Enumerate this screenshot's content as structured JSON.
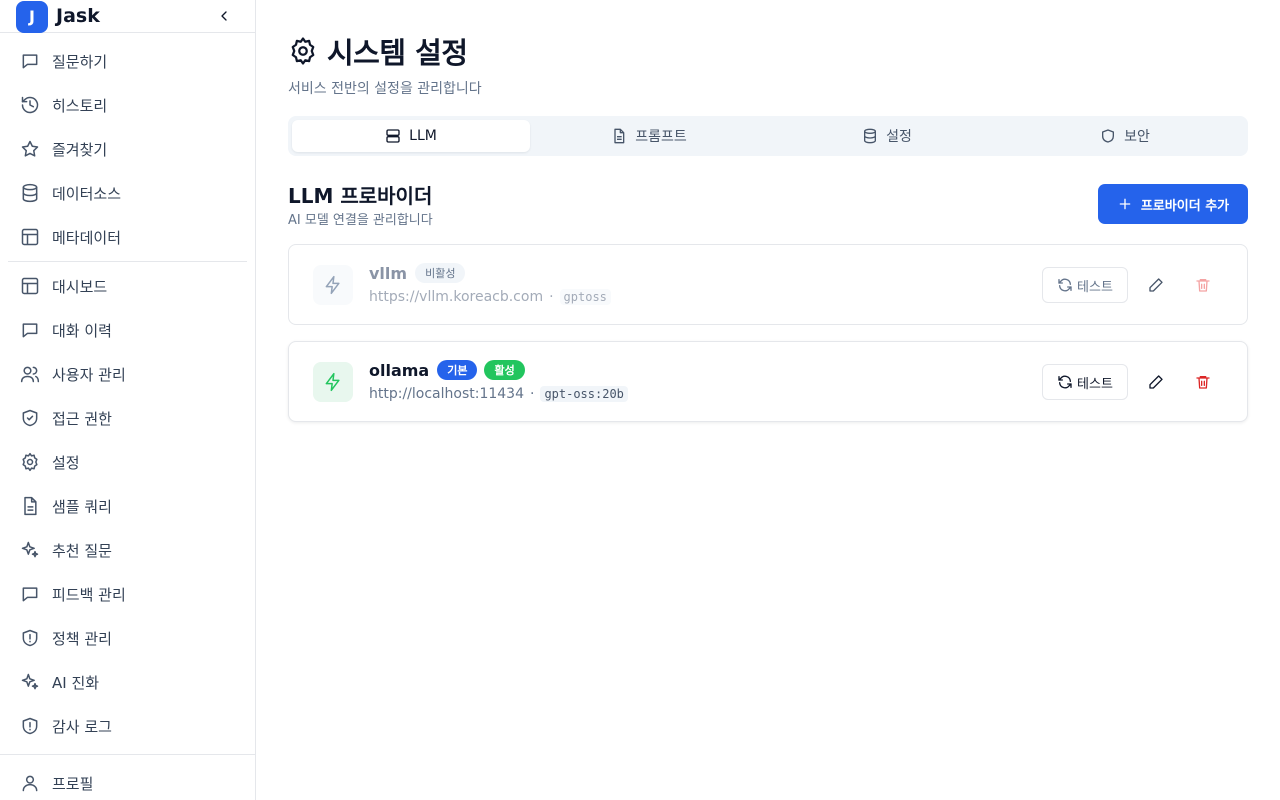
{
  "brand": {
    "logo_letter": "J",
    "name": "Jask"
  },
  "sidebar": {
    "group1": [
      {
        "label": "질문하기",
        "icon": "message-icon"
      },
      {
        "label": "히스토리",
        "icon": "history-icon"
      },
      {
        "label": "즐겨찾기",
        "icon": "star-icon"
      },
      {
        "label": "데이터소스",
        "icon": "database-icon"
      },
      {
        "label": "메타데이터",
        "icon": "layout-icon"
      }
    ],
    "group2": [
      {
        "label": "대시보드",
        "icon": "layout-icon"
      },
      {
        "label": "대화 이력",
        "icon": "message-icon"
      },
      {
        "label": "사용자 관리",
        "icon": "users-icon"
      },
      {
        "label": "접근 권한",
        "icon": "shield-check-icon"
      },
      {
        "label": "설정",
        "icon": "gear-icon"
      },
      {
        "label": "샘플 쿼리",
        "icon": "file-icon"
      },
      {
        "label": "추천 질문",
        "icon": "sparkles-icon"
      },
      {
        "label": "피드백 관리",
        "icon": "message-icon"
      },
      {
        "label": "정책 관리",
        "icon": "shield-alert-icon"
      },
      {
        "label": "AI 진화",
        "icon": "sparkles-icon"
      },
      {
        "label": "감사 로그",
        "icon": "shield-alert-icon"
      }
    ],
    "group3": [
      {
        "label": "프로필",
        "icon": "user-icon"
      }
    ]
  },
  "header": {
    "title": "시스템 설정",
    "subtitle": "서비스 전반의 설정을 관리합니다"
  },
  "tabs": [
    {
      "label": "LLM",
      "icon": "server-icon",
      "active": true
    },
    {
      "label": "프롬프트",
      "icon": "file-icon",
      "active": false
    },
    {
      "label": "설정",
      "icon": "database-icon",
      "active": false
    },
    {
      "label": "보안",
      "icon": "shield-icon",
      "active": false
    }
  ],
  "section": {
    "title": "LLM 프로바이더",
    "subtitle": "AI 모델 연결을 관리합니다",
    "add_label": "프로바이더 추가"
  },
  "providers": [
    {
      "name": "vllm",
      "badges": [
        "비활성"
      ],
      "url": "https://vllm.koreacb.com",
      "separator": "·",
      "model": "gptoss",
      "test_label": "테스트"
    },
    {
      "name": "ollama",
      "badges": [
        "기본",
        "활성"
      ],
      "url": "http://localhost:11434",
      "separator": "·",
      "model": "gpt-oss:20b",
      "test_label": "테스트"
    }
  ],
  "colors": {
    "accent": "#2563eb",
    "active_green": "#22c55e",
    "danger": "#dc2626",
    "border": "#e5e7eb"
  }
}
